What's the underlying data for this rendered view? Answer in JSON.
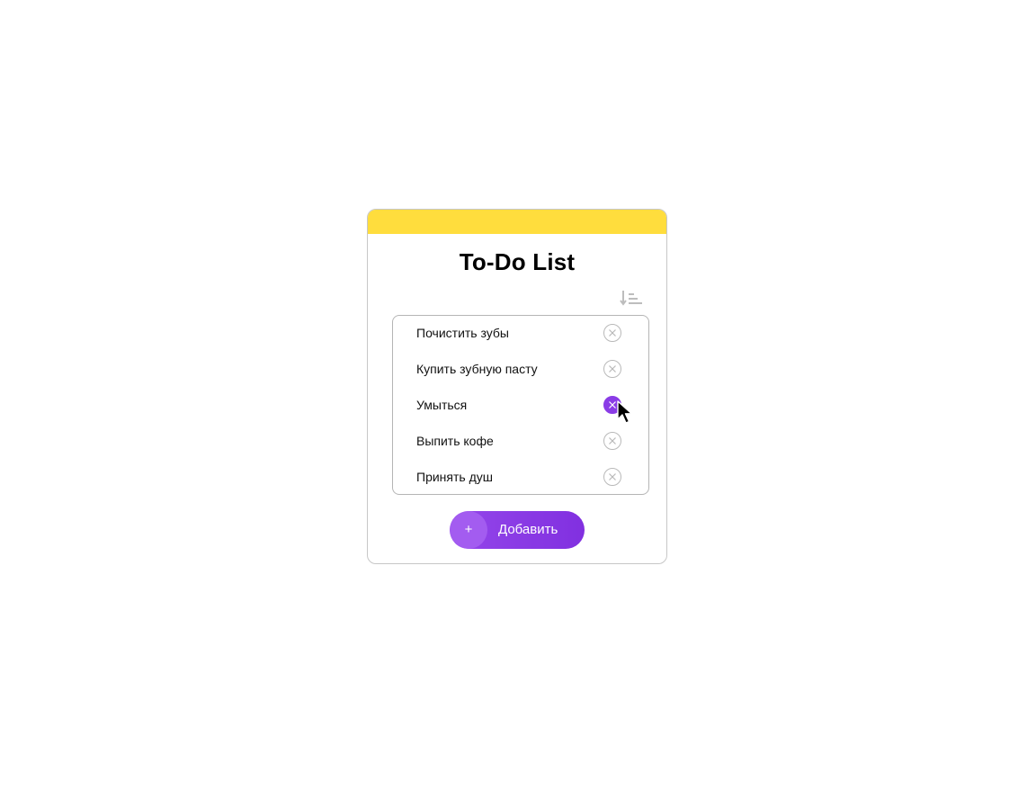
{
  "app": {
    "title": "To-Do List"
  },
  "colors": {
    "header": "#ffdd3d",
    "accent": "#8a3ce6",
    "button_light": "#a35cf0"
  },
  "toolbar": {
    "sort_icon": "sort-icon"
  },
  "tasks": [
    {
      "label": "Почистить зубы",
      "delete_icon": "close-circle-icon",
      "hover": false
    },
    {
      "label": "Купить зубную пасту",
      "delete_icon": "close-circle-icon",
      "hover": false
    },
    {
      "label": "Умыться",
      "delete_icon": "close-circle-icon",
      "hover": true
    },
    {
      "label": "Выпить кофе",
      "delete_icon": "close-circle-icon",
      "hover": false
    },
    {
      "label": "Принять душ",
      "delete_icon": "close-circle-icon",
      "hover": false
    }
  ],
  "add_button": {
    "icon": "+",
    "label": "Добавить"
  },
  "pointer": {
    "icon": "mouse-pointer-icon"
  }
}
